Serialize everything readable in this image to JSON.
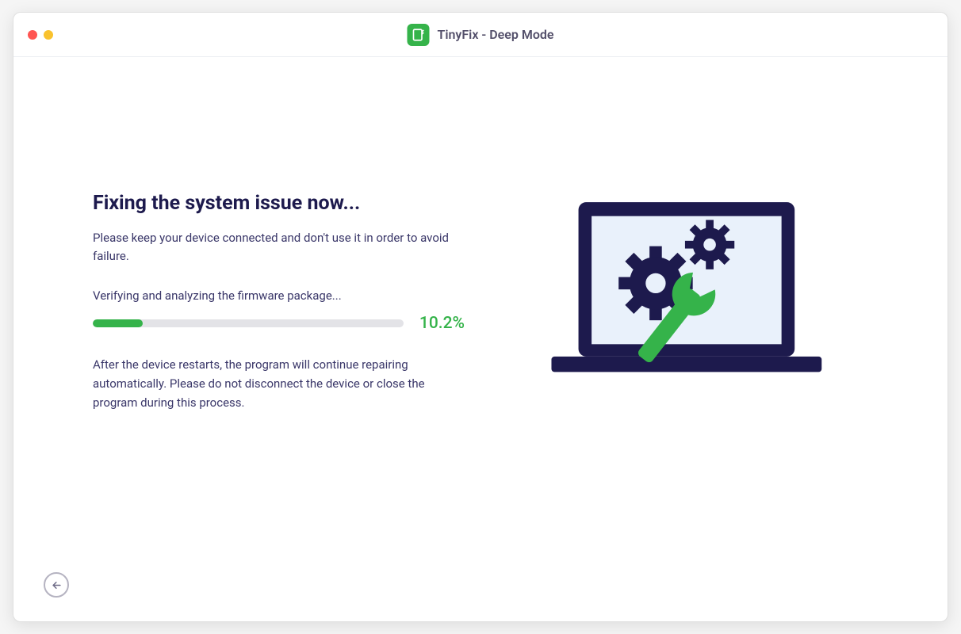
{
  "titlebar": {
    "app_title": "TinyFix - Deep Mode"
  },
  "main": {
    "heading": "Fixing the system issue now...",
    "subtext": "Please keep your device connected and don't use it in order to avoid failure.",
    "status": "Verifying and analyzing the firmware package...",
    "progress_percent": "10.2%",
    "progress_value": 10.2,
    "note": "After the device restarts, the program will continue repairing automatically. Please do not disconnect the device or close the program during this process."
  },
  "colors": {
    "accent_green": "#35b34a",
    "text_dark": "#1d1a4d",
    "text_body": "#3a3769"
  }
}
